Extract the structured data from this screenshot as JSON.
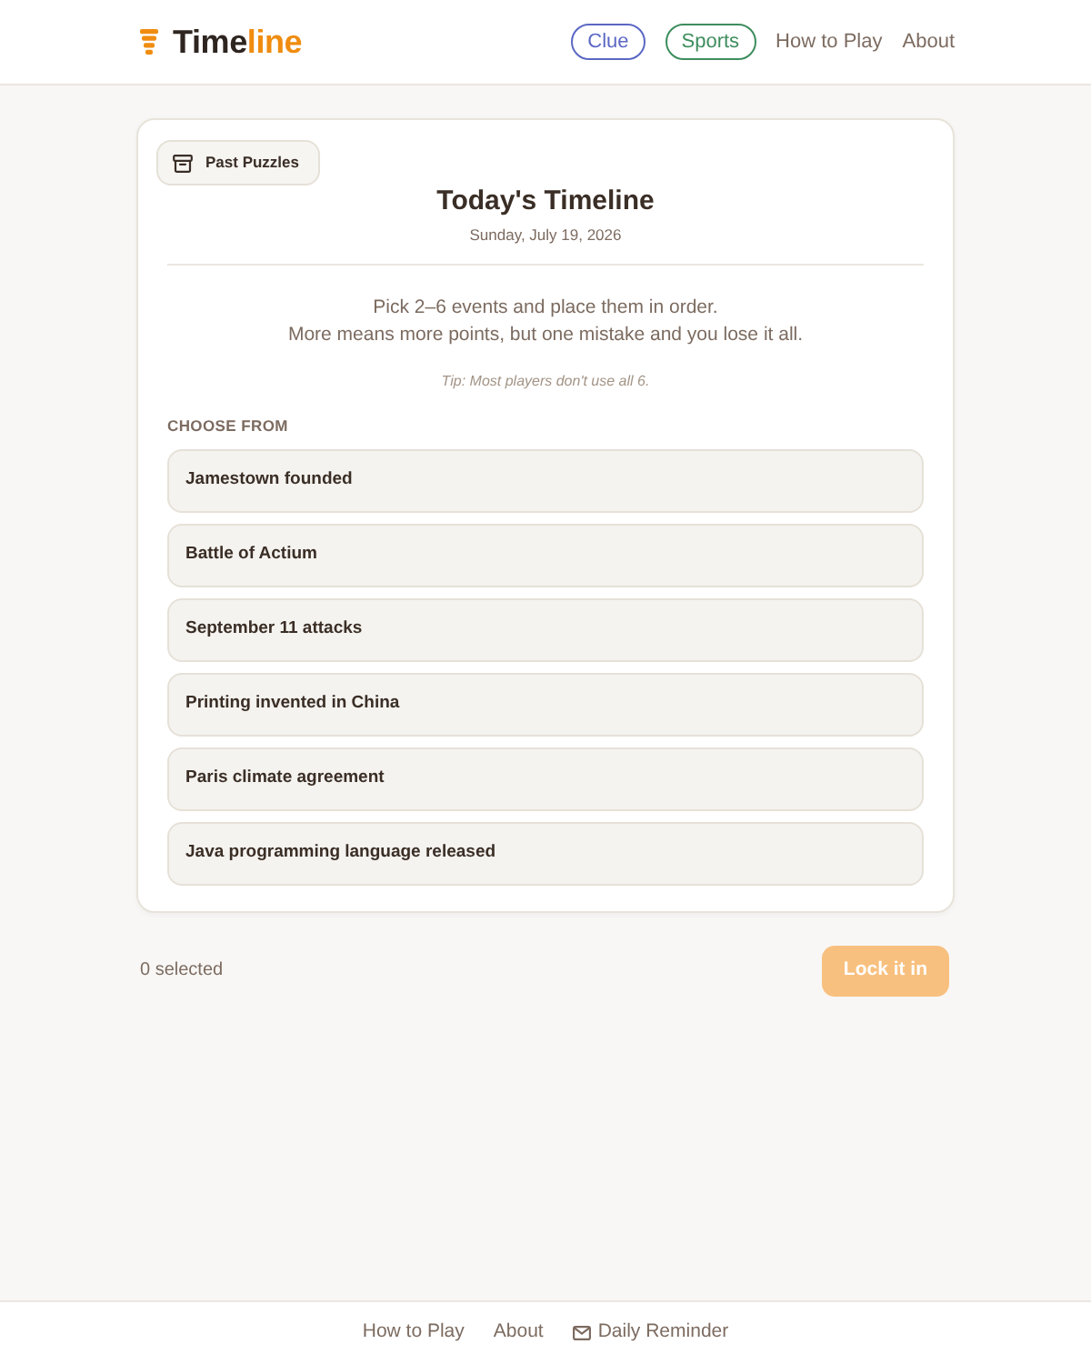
{
  "header": {
    "logo": {
      "main": "Time",
      "accent": "line"
    },
    "nav": [
      {
        "kind": "pill",
        "label": "Clue",
        "color": "#5b68c4"
      },
      {
        "kind": "pill",
        "label": "Sports",
        "color": "#3e8d5e"
      },
      {
        "kind": "link",
        "label": "How to Play"
      },
      {
        "kind": "link",
        "label": "About"
      }
    ]
  },
  "puzzle": {
    "past_button": "Past Puzzles",
    "title": "Today's Timeline",
    "date": "Sunday, July 19, 2026",
    "instructions": [
      "Pick 2–6 events and place them in order.",
      "More means more points, but one mistake and you lose it all."
    ],
    "tip": "Tip: Most players don't use all 6.",
    "section_label": "CHOOSE FROM",
    "events": [
      {
        "label": "Jamestown founded",
        "selected": false
      },
      {
        "label": "Battle of Actium",
        "selected": false
      },
      {
        "label": "September 11 attacks",
        "selected": false
      },
      {
        "label": "Printing invented in China",
        "selected": false
      },
      {
        "label": "Paris climate agreement",
        "selected": false
      },
      {
        "label": "Java programming language released",
        "selected": false
      }
    ]
  },
  "action_bar": {
    "selected_count": "0 selected",
    "submit": {
      "label": "Lock it in",
      "disabled": true
    }
  },
  "footer": {
    "links": [
      {
        "kind": "link",
        "label": "How to Play"
      },
      {
        "kind": "link",
        "label": "About"
      },
      {
        "kind": "mail",
        "label": "Daily Reminder"
      }
    ]
  }
}
